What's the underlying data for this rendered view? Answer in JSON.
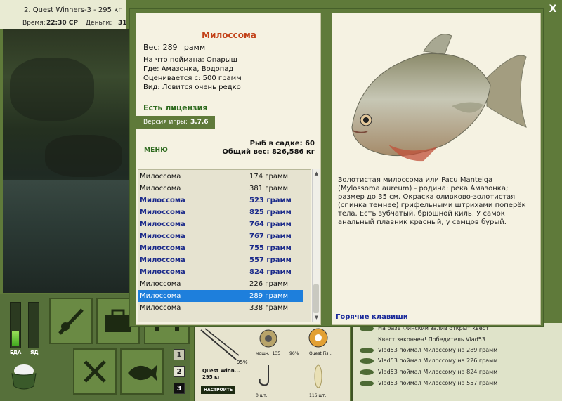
{
  "topbar": {
    "title": "2. Quest Winners-3 - 295 кг",
    "time_label": "Время:",
    "time_value": "22:30 СР",
    "money_label": "Деньги:",
    "money_value": "31"
  },
  "fish": {
    "name": "Милоссома",
    "weight": "Вес: 289 грамм",
    "caught_with": "На что поймана: Опарыш",
    "where": "Где: Амазонка, Водопад",
    "valued_from": "Оценивается с: 500 грамм",
    "kind": "Вид: Ловится очень редко",
    "description": "Золотистая милоссома или Pacu Manteiga (Mylossoma aureum) - родина: река Амазонка; размер до 35 см. Окраска оливково-золотистая (спинка темнее) грифельными штрихами поперёк тела. Есть зубчатый, брюшной киль. У самок анальный плавник красный, у самцов бурый."
  },
  "license": "Есть лицензия",
  "version": {
    "label": "Версия игры:",
    "value": "3.7.6"
  },
  "menu_label": "МЕНЮ",
  "stats": {
    "in_keepnet": "Рыб в садке: 60",
    "total_weight": "Общий вес: 826,586 кг"
  },
  "catches": [
    {
      "name": "Милоссома",
      "weight": "174 грамм",
      "bold": false,
      "selected": false
    },
    {
      "name": "Милоссома",
      "weight": "381 грамм",
      "bold": false,
      "selected": false
    },
    {
      "name": "Милоссома",
      "weight": "523 грамм",
      "bold": true,
      "selected": false
    },
    {
      "name": "Милоссома",
      "weight": "825 грамм",
      "bold": true,
      "selected": false
    },
    {
      "name": "Милоссома",
      "weight": "764 грамм",
      "bold": true,
      "selected": false
    },
    {
      "name": "Милоссома",
      "weight": "767 грамм",
      "bold": true,
      "selected": false
    },
    {
      "name": "Милоссома",
      "weight": "755 грамм",
      "bold": true,
      "selected": false
    },
    {
      "name": "Милоссома",
      "weight": "557 грамм",
      "bold": true,
      "selected": false
    },
    {
      "name": "Милоссома",
      "weight": "824 грамм",
      "bold": true,
      "selected": false
    },
    {
      "name": "Милоссома",
      "weight": "226 грамм",
      "bold": false,
      "selected": false
    },
    {
      "name": "Милоссома",
      "weight": "289 грамм",
      "bold": false,
      "selected": true
    },
    {
      "name": "Милоссома",
      "weight": "338 грамм",
      "bold": false,
      "selected": false
    }
  ],
  "hotkeys": "Горячие клавиши",
  "close_glyph": "X",
  "left_ui": {
    "food_label": "ЕДА",
    "poison_label": "ЯД",
    "food_level": 0.35,
    "poison_level": 0.0,
    "num_buttons": [
      "1",
      "2",
      "3"
    ]
  },
  "gear": {
    "rod_name": "Quest Winn...",
    "rod_weight": "295 кг",
    "rod_percent": "95%",
    "reel_label": "мощн.: 135",
    "reel_percent": "96%",
    "line_label": "Quest Fis...",
    "configure_label": "НАСТРОИТЬ",
    "hook_count": "0 шт.",
    "bait_count": "116 шт."
  },
  "log": [
    "На базе Финский залив открыт квест",
    "Квест закончен! Победитель Vlad53",
    "Vlad53 поймал Милоссому на 289 грамм",
    "Vlad53 поймал Милоссому на 226 грамм",
    "Vlad53 поймал Милоссому на 824 грамм",
    "Vlad53 поймал Милоссому на 557 грамм"
  ],
  "colors": {
    "accent": "#5f7a3a",
    "fish_title": "#c24118",
    "list_selected": "#1e7fdc",
    "list_bold": "#1b2a8a"
  }
}
